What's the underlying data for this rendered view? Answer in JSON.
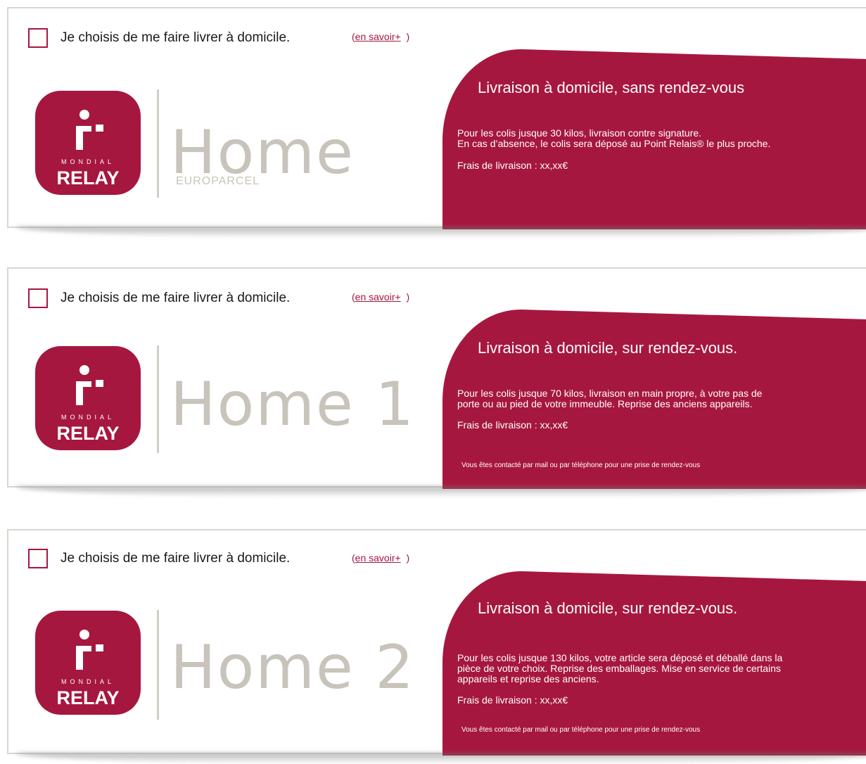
{
  "colors": {
    "brand": "#a6173f",
    "muted": "#c8c3bb",
    "border": "#d9d6cf"
  },
  "logo": {
    "line1": "MONDIAL",
    "line2": "RELAY"
  },
  "options": [
    {
      "checkbox_label": "Je choisis de me faire livrer à domicile.",
      "more_open": "(",
      "more_link": "en savoir+",
      "more_close": ")",
      "brand": "Home",
      "brand_sub": "EUROPARCEL",
      "title": "Livraison à domicile, sans rendez-vous",
      "desc_lines": [
        "Pour les colis jusque 30 kilos, livraison contre signature.",
        "En cas d’absence, le colis sera déposé au Point Relais® le plus proche."
      ],
      "fee": "Frais de livraison : xx,xx€",
      "note": ""
    },
    {
      "checkbox_label": "Je choisis de me faire livrer à domicile.",
      "more_open": "(",
      "more_link": "en savoir+",
      "more_close": ")",
      "brand": "Home 1",
      "brand_sub": "",
      "title": "Livraison à domicile, sur rendez-vous.",
      "desc_lines": [
        "Pour les colis jusque 70 kilos, livraison en main propre, à votre pas de",
        "porte ou au pied de votre immeuble. Reprise des anciens appareils."
      ],
      "fee": "Frais de livraison : xx,xx€",
      "note": "Vous êtes contacté par mail ou par téléphone pour une prise de rendez-vous"
    },
    {
      "checkbox_label": "Je choisis de me faire livrer à domicile.",
      "more_open": "(",
      "more_link": "en savoir+",
      "more_close": ")",
      "brand": "Home 2",
      "brand_sub": "",
      "title": "Livraison à domicile, sur rendez-vous.",
      "desc_lines": [
        "Pour les colis jusque 130 kilos, votre article sera déposé et déballé dans la",
        "pièce de votre choix. Reprise des emballages. Mise en service de certains",
        "appareils et reprise des anciens."
      ],
      "fee": "Frais de livraison : xx,xx€",
      "note": "Vous êtes contacté par mail ou par téléphone pour une prise de rendez-vous"
    }
  ]
}
